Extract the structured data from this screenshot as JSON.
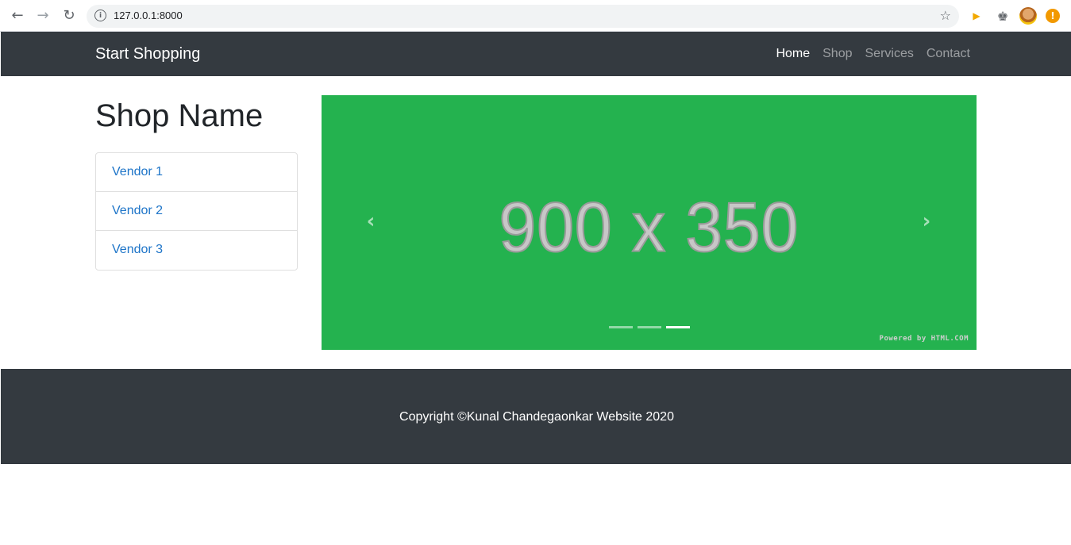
{
  "browser": {
    "url": "127.0.0.1:8000",
    "icons": {
      "back": "arrow-left-icon",
      "forward": "arrow-right-icon",
      "reload": "reload-icon",
      "info": "info-icon",
      "star": "star-icon",
      "extension": "play-arrow-icon",
      "puzzle": "puzzle-icon",
      "alert": "alert-icon"
    }
  },
  "navbar": {
    "brand": "Start Shopping",
    "links": [
      {
        "label": "Home",
        "active": true
      },
      {
        "label": "Shop",
        "active": false
      },
      {
        "label": "Services",
        "active": false
      },
      {
        "label": "Contact",
        "active": false
      }
    ],
    "background": "#343a40"
  },
  "sidebar": {
    "title": "Shop Name",
    "vendors": [
      "Vendor 1",
      "Vendor 2",
      "Vendor 3"
    ]
  },
  "carousel": {
    "slide_text": "900 x 350",
    "background": "#24b24f",
    "prev_symbol": "‹",
    "next_symbol": "›",
    "indicator_count": 3,
    "active_indicator": 3,
    "powered_by": "Powered by HTML.COM"
  },
  "footer": {
    "copyright": "Copyright ©Kunal Chandegaonkar Website 2020",
    "background": "#343a40"
  }
}
